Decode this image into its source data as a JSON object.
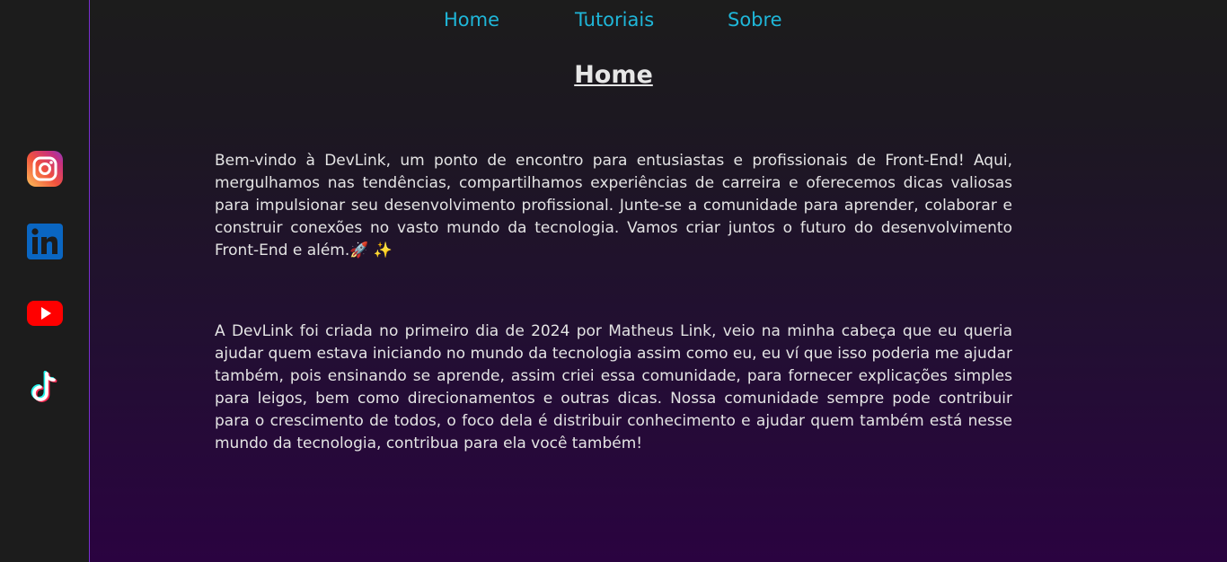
{
  "nav": {
    "items": [
      "Home",
      "Tutoriais",
      "Sobre"
    ]
  },
  "page": {
    "title": "Home",
    "paragraphs": [
      "Bem-vindo à DevLink, um ponto de encontro para entusiastas e profissionais de Front-End! Aqui, mergulhamos nas tendências, compartilhamos experiências de carreira e oferecemos dicas valiosas para impulsionar seu desenvolvimento profissional. Junte-se a comunidade para aprender, colaborar e construir conexões no vasto mundo da tecnologia. Vamos criar juntos o futuro do desenvolvimento Front-End e além.🚀 ✨",
      "A DevLink foi criada no primeiro dia de 2024 por Matheus Link, veio na minha cabeça que eu queria ajudar quem estava iniciando no mundo da tecnologia assim como eu, eu ví que isso poderia me ajudar também, pois ensinando se aprende, assim criei essa comunidade, para fornecer explicações simples para leigos, bem como direcionamentos e outras dicas. Nossa comunidade sempre pode contribuir para o crescimento de todos, o foco dela é distribuir conhecimento e ajudar quem também está nesse mundo da tecnologia, contribua para ela você também!"
    ]
  },
  "social": {
    "icons": [
      "instagram-icon",
      "linkedin-icon",
      "youtube-icon",
      "tiktok-icon"
    ]
  },
  "colors": {
    "accent": "#1fb6d8",
    "sidebar_border": "#7a2fd0",
    "background_top": "#1c1c1c",
    "background_bottom": "#2a0340"
  }
}
